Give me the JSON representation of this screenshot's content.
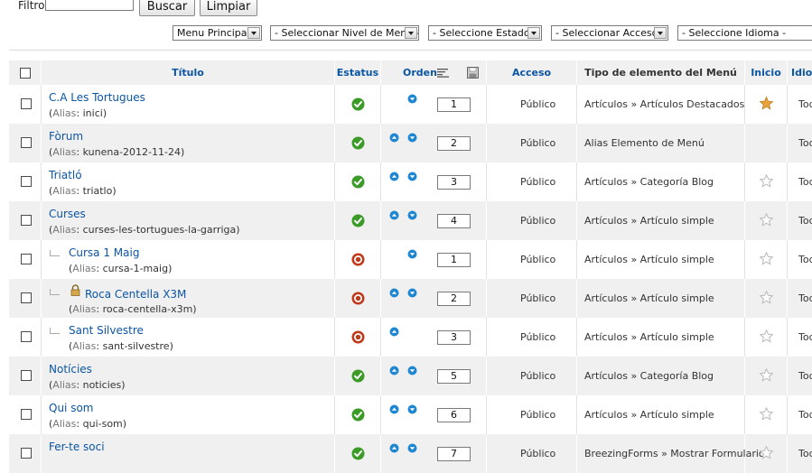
{
  "filter": {
    "label": "Filtro:",
    "value": "",
    "search_button": "Buscar",
    "clear_button": "Limpiar"
  },
  "selects": {
    "menu": "Menu Principal",
    "level": "- Seleccionar Nivel de Menú -",
    "state": "- Seleccione Estado -",
    "access": "- Seleccionar Acceso -",
    "language": "- Seleccione Idioma -"
  },
  "columns": {
    "title": "Título",
    "status": "Estatus",
    "order": "Orden",
    "access": "Acceso",
    "type": "Tipo de elemento del Menú",
    "home": "Inicio",
    "language": "Idioma"
  },
  "alias_label": "Alias",
  "colors": {
    "link": "#0b55a3",
    "published": "#3a9b27",
    "unpublished": "#c0391a",
    "arrow": "#1f86d1",
    "star": "#e8a33a",
    "row_alt": "#f0f0f0"
  },
  "rows": [
    {
      "title": "C.A Les Tortugues",
      "alias": "inici",
      "level": 1,
      "status": "published",
      "up": false,
      "down": true,
      "order": "1",
      "access": "Público",
      "type": "Artículos » Artículos Destacados",
      "home": "star-filled",
      "language": "Todos",
      "locked": false
    },
    {
      "title": "Fòrum",
      "alias": "kunena-2012-11-24",
      "level": 1,
      "status": "published",
      "up": true,
      "down": true,
      "order": "2",
      "access": "Público",
      "type": "Alias Elemento de Menú",
      "home": "none",
      "language": "Todos",
      "locked": false
    },
    {
      "title": "Triatló",
      "alias": "triatlo",
      "level": 1,
      "status": "published",
      "up": true,
      "down": true,
      "order": "3",
      "access": "Público",
      "type": "Artículos » Categoría Blog",
      "home": "star-empty",
      "language": "Todos",
      "locked": false
    },
    {
      "title": "Curses",
      "alias": "curses-les-tortugues-la-garriga",
      "level": 1,
      "status": "published",
      "up": true,
      "down": true,
      "order": "4",
      "access": "Público",
      "type": "Artículos » Artículo simple",
      "home": "star-empty",
      "language": "Todos",
      "locked": false
    },
    {
      "title": "Cursa 1 Maig",
      "alias": "cursa-1-maig",
      "level": 2,
      "status": "unpublished",
      "up": false,
      "down": true,
      "order": "1",
      "access": "Público",
      "type": "Artículos » Artículo simple",
      "home": "star-empty",
      "language": "Todos",
      "locked": false
    },
    {
      "title": "Roca Centella X3M",
      "alias": "roca-centella-x3m",
      "level": 2,
      "status": "unpublished",
      "up": true,
      "down": true,
      "order": "2",
      "access": "Público",
      "type": "Artículos » Artículo simple",
      "home": "star-empty",
      "language": "Todos",
      "locked": true
    },
    {
      "title": "Sant Silvestre",
      "alias": "sant-silvestre",
      "level": 2,
      "status": "unpublished",
      "up": true,
      "down": false,
      "order": "3",
      "access": "Público",
      "type": "Artículos » Artículo simple",
      "home": "star-empty",
      "language": "Todos",
      "locked": false
    },
    {
      "title": "Notícies",
      "alias": "noticies",
      "level": 1,
      "status": "published",
      "up": true,
      "down": true,
      "order": "5",
      "access": "Público",
      "type": "Artículos » Categoría Blog",
      "home": "star-empty",
      "language": "Todos",
      "locked": false
    },
    {
      "title": "Qui som",
      "alias": "qui-som",
      "level": 1,
      "status": "published",
      "up": true,
      "down": true,
      "order": "6",
      "access": "Público",
      "type": "Artículos » Artículo simple",
      "home": "star-empty",
      "language": "Todos",
      "locked": false
    },
    {
      "title": "Fer-te soci",
      "alias": "",
      "level": 1,
      "status": "published",
      "up": true,
      "down": true,
      "order": "7",
      "access": "Público",
      "type": "BreezingForms » Mostrar Formulario",
      "home": "star-empty",
      "language": "Todos",
      "locked": false
    }
  ]
}
